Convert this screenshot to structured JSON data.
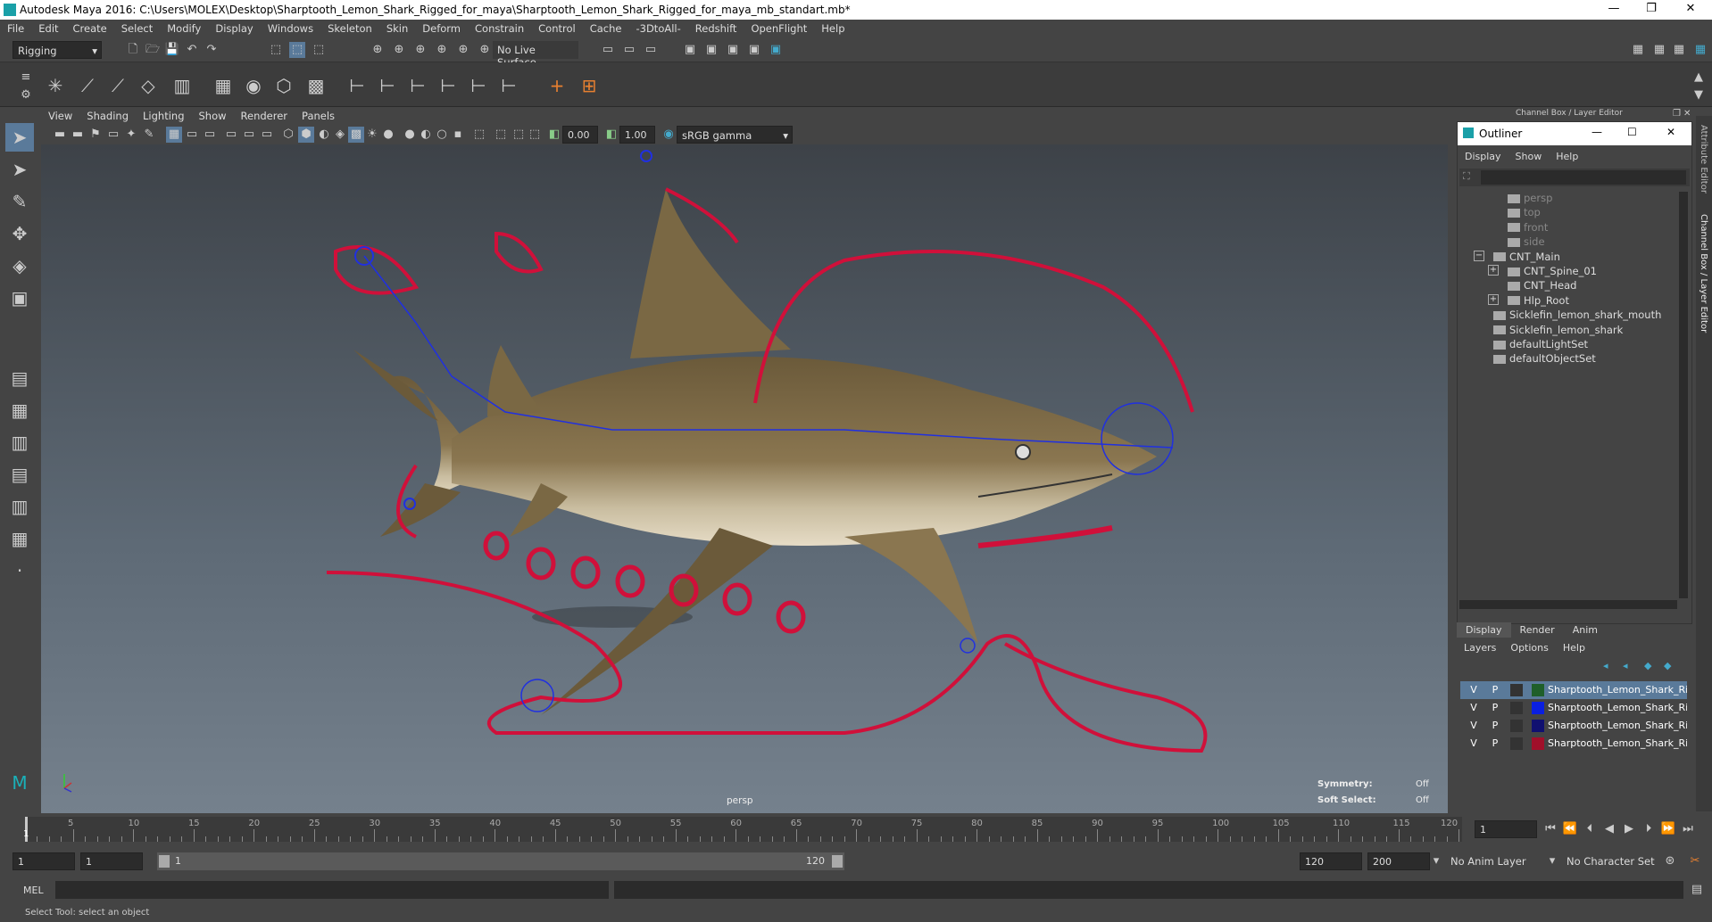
{
  "window": {
    "title": "Autodesk Maya 2016: C:\\Users\\MOLEX\\Desktop\\Sharptooth_Lemon_Shark_Rigged_for_maya\\Sharptooth_Lemon_Shark_Rigged_for_maya_mb_standart.mb*",
    "minimize": "—",
    "restore": "❐",
    "close": "✕"
  },
  "menubar": [
    "File",
    "Edit",
    "Create",
    "Select",
    "Modify",
    "Display",
    "Windows",
    "Skeleton",
    "Skin",
    "Deform",
    "Constrain",
    "Control",
    "Cache",
    "-3DtoAll-",
    "Redshift",
    "OpenFlight",
    "Help"
  ],
  "statusline": {
    "mode": "Rigging",
    "live_surface": "No Live Surface"
  },
  "viewport": {
    "menu": [
      "View",
      "Shading",
      "Lighting",
      "Show",
      "Renderer",
      "Panels"
    ],
    "exposure": "0.00",
    "gamma": "1.00",
    "colorspace": "sRGB gamma",
    "camera": "persp",
    "symmetry_label": "Symmetry:",
    "symmetry_value": "Off",
    "softselect_label": "Soft Select:",
    "softselect_value": "Off"
  },
  "panel": {
    "header": "Channel Box / Layer Editor",
    "side_tabs": [
      "Attribute Editor",
      "Channel Box / Layer Editor"
    ]
  },
  "outliner": {
    "title": "Outliner",
    "menu": [
      "Display",
      "Show",
      "Help"
    ],
    "items": [
      {
        "label": "persp",
        "dim": true
      },
      {
        "label": "top",
        "dim": true
      },
      {
        "label": "front",
        "dim": true
      },
      {
        "label": "side",
        "dim": true
      },
      {
        "label": "CNT_Main",
        "dim": false
      },
      {
        "label": "CNT_Spine_01",
        "dim": false
      },
      {
        "label": "CNT_Head",
        "dim": false
      },
      {
        "label": "Hlp_Root",
        "dim": false
      },
      {
        "label": "Sicklefin_lemon_shark_mouth",
        "dim": false
      },
      {
        "label": "Sicklefin_lemon_shark",
        "dim": false
      },
      {
        "label": "defaultLightSet",
        "dim": false
      },
      {
        "label": "defaultObjectSet",
        "dim": false
      }
    ]
  },
  "layers": {
    "tabs": [
      "Display",
      "Render",
      "Anim"
    ],
    "menu": [
      "Layers",
      "Options",
      "Help"
    ],
    "rows": [
      {
        "v": "V",
        "p": "P",
        "color": "#1f5f2a",
        "name": "Sharptooth_Lemon_Shark_Rigge",
        "selected": true
      },
      {
        "v": "V",
        "p": "P",
        "color": "#0a1fe0",
        "name": "Sharptooth_Lemon_Shark_Rigge",
        "selected": false
      },
      {
        "v": "V",
        "p": "P",
        "color": "#101070",
        "name": "Sharptooth_Lemon_Shark_Rigge",
        "selected": false
      },
      {
        "v": "V",
        "p": "P",
        "color": "#a0102a",
        "name": "Sharptooth_Lemon_Shark_Rigge",
        "selected": false
      }
    ]
  },
  "timeline": {
    "ticks": [
      "5",
      "10",
      "15",
      "20",
      "25",
      "30",
      "35",
      "40",
      "45",
      "50",
      "55",
      "60",
      "65",
      "70",
      "75",
      "80",
      "85",
      "90",
      "95",
      "100",
      "105",
      "110",
      "115",
      "120"
    ],
    "first_label": "1",
    "current_frame": "1"
  },
  "range": {
    "start": "1",
    "playback_start": "1",
    "slider_start": "1",
    "slider_end": "120",
    "playback_end": "120",
    "end": "200",
    "anim_layer": "No Anim Layer",
    "char_set": "No Character Set"
  },
  "cmd": {
    "label": "MEL"
  },
  "help": "Select Tool: select an object",
  "colors": {
    "control_curve": "#d0103a",
    "joint": "#2030e0",
    "shark_body": "#8a7650"
  }
}
